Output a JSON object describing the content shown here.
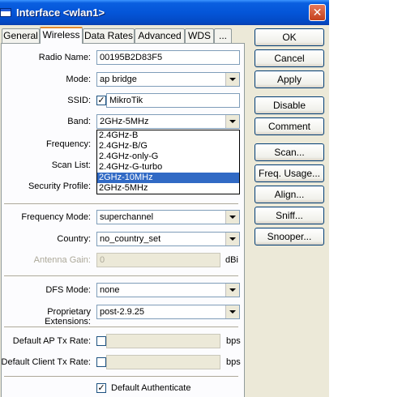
{
  "window": {
    "title": "Interface <wlan1>",
    "close_glyph": "✕"
  },
  "tabs": [
    "General",
    "Wireless",
    "Data Rates",
    "Advanced",
    "WDS",
    "..."
  ],
  "form": {
    "radio_name": {
      "label": "Radio Name:",
      "value": "00195B2D83F5"
    },
    "mode": {
      "label": "Mode:",
      "value": "ap bridge"
    },
    "ssid": {
      "label": "SSID:",
      "value": "MikroTik",
      "checked_glyph": "✓"
    },
    "band": {
      "label": "Band:",
      "value": "2GHz-5MHz"
    },
    "frequency": {
      "label": "Frequency:"
    },
    "scan_list": {
      "label": "Scan List:"
    },
    "security_profile": {
      "label": "Security Profile:"
    },
    "frequency_mode": {
      "label": "Frequency Mode:",
      "value": "superchannel"
    },
    "country": {
      "label": "Country:",
      "value": "no_country_set"
    },
    "antenna_gain": {
      "label": "Antenna Gain:",
      "value": "0",
      "unit": "dBi"
    },
    "dfs_mode": {
      "label": "DFS Mode:",
      "value": "none"
    },
    "proprietary_extensions": {
      "label": "Proprietary Extensions:",
      "value": "post-2.9.25"
    },
    "default_ap_tx_rate": {
      "label": "Default AP Tx Rate:",
      "unit": "bps"
    },
    "default_client_tx_rate": {
      "label": "Default Client Tx Rate:",
      "unit": "bps"
    },
    "default_authenticate": {
      "label": "Default Authenticate",
      "checked_glyph": "✓"
    }
  },
  "band_options": [
    "2.4GHz-B",
    "2.4GHz-B/G",
    "2.4GHz-only-G",
    "2.4GHz-G-turbo",
    "2GHz-10MHz",
    "2GHz-5MHz"
  ],
  "band_highlighted": "2GHz-10MHz",
  "buttons": [
    "OK",
    "Cancel",
    "Apply",
    "Disable",
    "Comment",
    "Scan...",
    "Freq. Usage...",
    "Align...",
    "Sniff...",
    "Snooper..."
  ],
  "colors": {
    "titlebar": "#0455d8",
    "selection": "#316ac5",
    "active_tab_accent": "#e68b2c"
  }
}
